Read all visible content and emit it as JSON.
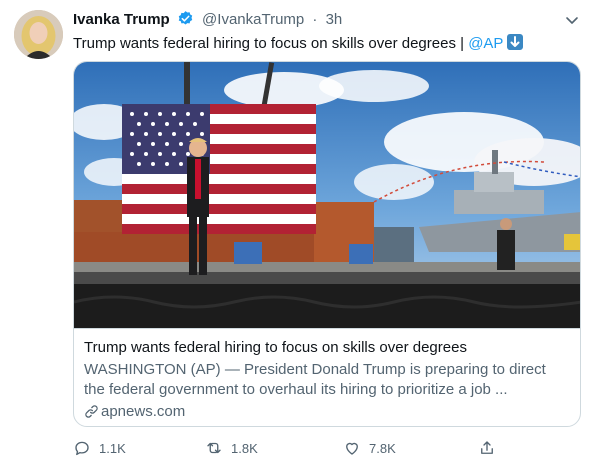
{
  "author": {
    "name": "Ivanka Trump",
    "handle": "@IvankaTrump",
    "separator": "·",
    "time": "3h"
  },
  "tweet": {
    "text": "Trump wants federal hiring to focus on skills over degrees | ",
    "mention": "@AP",
    "emoji": "down-arrow-emoji"
  },
  "card": {
    "title": "Trump wants federal hiring to focus on skills over degrees",
    "description": "WASHINGTON (AP) — President Donald Trump is preparing to direct the federal government to overhaul its hiring to prioritize a job ...",
    "domain": "apnews.com"
  },
  "actions": {
    "reply_count": "1.1K",
    "retweet_count": "1.8K",
    "like_count": "7.8K"
  },
  "colors": {
    "accent": "#1d9bf0",
    "secondary_text": "#536471",
    "border": "#cfd9de"
  }
}
